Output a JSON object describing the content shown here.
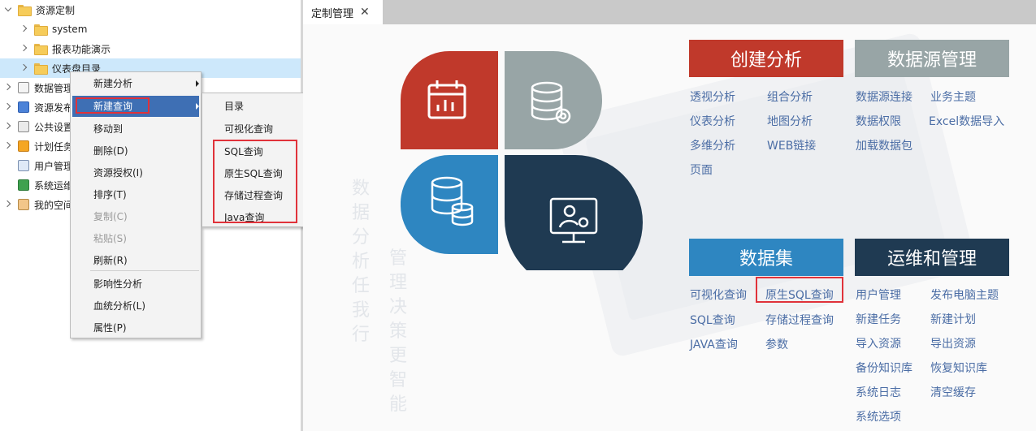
{
  "tree": {
    "root_label": "资源定制",
    "items": [
      {
        "label": "system"
      },
      {
        "label": "报表功能演示"
      },
      {
        "label": "仪表盘目录"
      },
      {
        "label": "数据管理"
      },
      {
        "label": "资源发布"
      },
      {
        "label": "公共设置"
      },
      {
        "label": "计划任务"
      },
      {
        "label": "用户管理"
      },
      {
        "label": "系统运维"
      },
      {
        "label": "我的空间"
      }
    ]
  },
  "context_menu": {
    "items": [
      {
        "label": "新建分析"
      },
      {
        "label": "新建查询"
      },
      {
        "label": "移动到"
      },
      {
        "label": "删除(D)"
      },
      {
        "label": "资源授权(I)"
      },
      {
        "label": "排序(T)"
      },
      {
        "label": "复制(C)"
      },
      {
        "label": "粘贴(S)"
      },
      {
        "label": "刷新(R)"
      },
      {
        "label": "影响性分析"
      },
      {
        "label": "血统分析(L)"
      },
      {
        "label": "属性(P)"
      }
    ]
  },
  "submenu": {
    "items": [
      {
        "label": "目录"
      },
      {
        "label": "可视化查询"
      },
      {
        "label": "SQL查询"
      },
      {
        "label": "原生SQL查询"
      },
      {
        "label": "存储过程查询"
      },
      {
        "label": "Java查询"
      }
    ]
  },
  "tab": {
    "label": "定制管理",
    "close": "✕"
  },
  "watermark": {
    "col1": "数据分析任我行",
    "col2": "管理决策更智能"
  },
  "colors": {
    "red": "#c0392b",
    "gray": "#98a5a6",
    "blue": "#2e86c1",
    "navy": "#1f3a52",
    "link": "#4b6da5",
    "highlight": "#e0323a"
  },
  "sections": {
    "create_analysis": {
      "title": "创建分析",
      "links": [
        "透视分析",
        "组合分析",
        "仪表分析",
        "地图分析",
        "多维分析",
        "WEB链接",
        "页面"
      ]
    },
    "datasource": {
      "title": "数据源管理",
      "links": [
        "数据源连接",
        "业务主题",
        "数据权限",
        "Excel数据导入",
        "加载数据包"
      ]
    },
    "dataset": {
      "title": "数据集",
      "links": [
        "可视化查询",
        "原生SQL查询",
        "SQL查询",
        "存储过程查询",
        "JAVA查询",
        "参数"
      ]
    },
    "ops": {
      "title": "运维和管理",
      "links": [
        "用户管理",
        "发布电脑主题",
        "新建任务",
        "新建计划",
        "导入资源",
        "导出资源",
        "备份知识库",
        "恢复知识库",
        "系统日志",
        "清空缓存",
        "系统选项"
      ]
    }
  }
}
